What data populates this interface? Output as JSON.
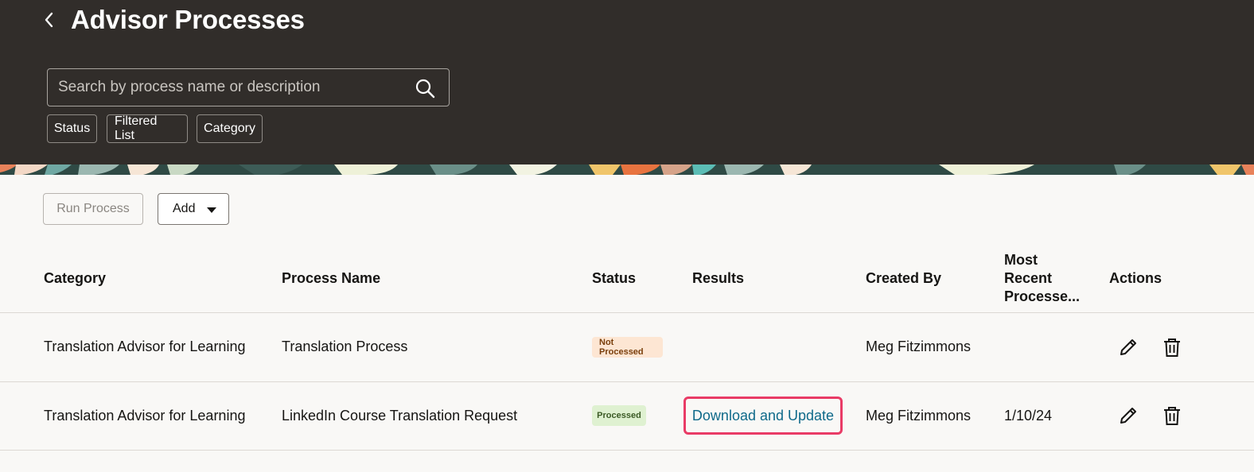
{
  "header": {
    "title": "Advisor Processes",
    "back_icon": "chevron-left-icon",
    "background_color": "#312d2a"
  },
  "search": {
    "placeholder": "Search by process name or description",
    "value": "",
    "icon": "search-icon"
  },
  "filters": [
    {
      "label": "Status"
    },
    {
      "label": "Filtered List"
    },
    {
      "label": "Category"
    }
  ],
  "toolbar": {
    "run_label": "Run Process",
    "add_label": "Add"
  },
  "table": {
    "columns": {
      "category": "Category",
      "process_name": "Process Name",
      "status": "Status",
      "results": "Results",
      "created_by": "Created By",
      "most_recent": "Most Recent Processe...",
      "actions": "Actions"
    },
    "rows": [
      {
        "category": "Translation Advisor for Learning",
        "process_name": "Translation Process",
        "status": "Not Processed",
        "status_color": "#fde6d3",
        "results": "",
        "created_by": "Meg Fitzimmons",
        "most_recent": ""
      },
      {
        "category": "Translation Advisor for Learning",
        "process_name": "LinkedIn Course Translation Request",
        "status": "Processed",
        "status_color": "#dff1d1",
        "results": "Download and Update",
        "created_by": "Meg Fitzimmons",
        "most_recent": "1/10/24"
      }
    ]
  },
  "colors": {
    "link": "#0f6a8a",
    "highlight": "#e93b66"
  }
}
